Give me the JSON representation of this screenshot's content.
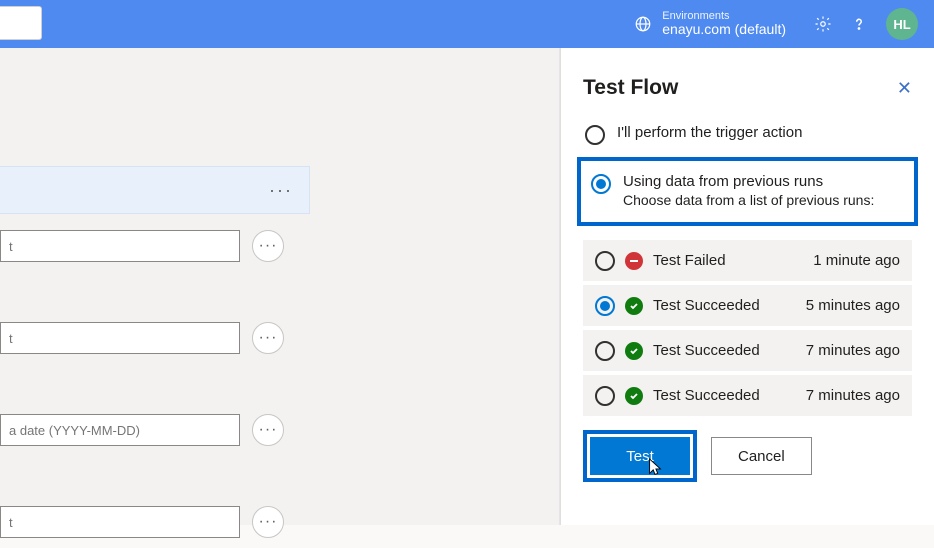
{
  "header": {
    "env_label": "Environments",
    "env_name": "enayu.com (default)",
    "avatar": "HL"
  },
  "designer": {
    "inputs": [
      {
        "placeholder": "t"
      },
      {
        "placeholder": "t"
      },
      {
        "placeholder": "a date (YYYY-MM-DD)"
      },
      {
        "placeholder": "t"
      }
    ]
  },
  "panel": {
    "title": "Test Flow",
    "options": {
      "manual": {
        "label": "I'll perform the trigger action"
      },
      "previous": {
        "label": "Using data from previous runs",
        "sub": "Choose data from a list of previous runs:"
      }
    },
    "runs": [
      {
        "status": "fail",
        "label": "Test Failed",
        "time": "1 minute ago",
        "selected": false
      },
      {
        "status": "success",
        "label": "Test Succeeded",
        "time": "5 minutes ago",
        "selected": true
      },
      {
        "status": "success",
        "label": "Test Succeeded",
        "time": "7 minutes ago",
        "selected": false
      },
      {
        "status": "success",
        "label": "Test Succeeded",
        "time": "7 minutes ago",
        "selected": false
      }
    ],
    "buttons": {
      "test": "Test",
      "cancel": "Cancel"
    }
  }
}
